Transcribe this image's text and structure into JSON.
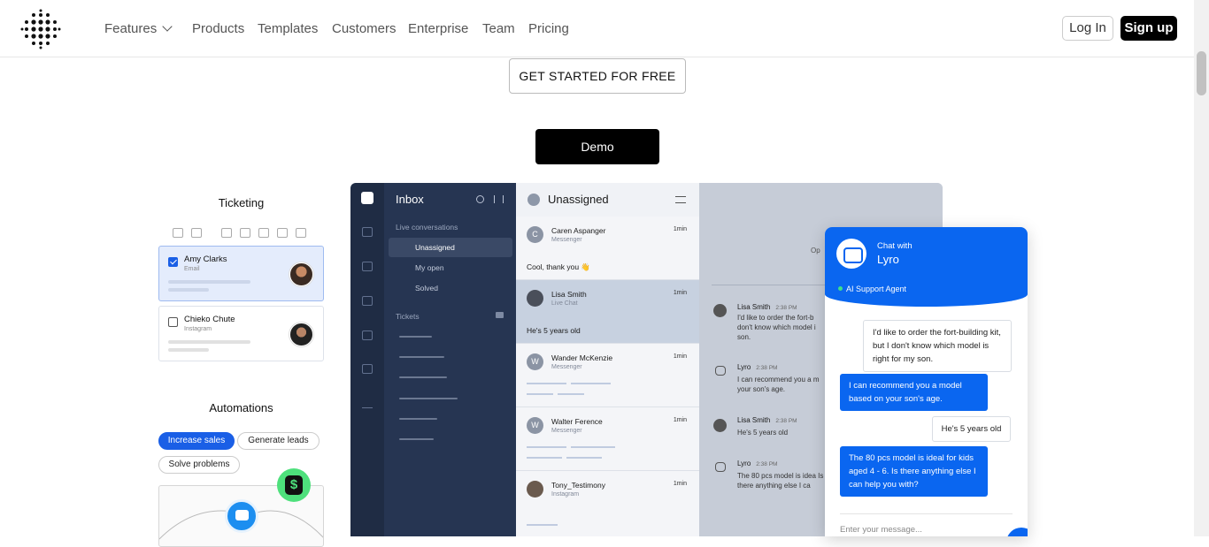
{
  "nav": {
    "items": [
      {
        "label": "Features"
      },
      {
        "label": "Products"
      },
      {
        "label": "Templates"
      },
      {
        "label": "Customers"
      },
      {
        "label": "Enterprise"
      },
      {
        "label": "Team"
      },
      {
        "label": "Pricing"
      }
    ],
    "login": "Log In",
    "signup": "Sign up"
  },
  "hero": {
    "cta_free": "GET STARTED FOR FREE",
    "cta_demo": "Demo"
  },
  "ticketing": {
    "title": "Ticketing",
    "tickets": [
      {
        "name": "Amy Clarks",
        "source": "Email"
      },
      {
        "name": "Chieko Chute",
        "source": "Instagram"
      }
    ]
  },
  "automations": {
    "title": "Automations",
    "pills": [
      "Increase sales",
      "Generate leads",
      "Solve problems"
    ],
    "dollar": "$"
  },
  "inbox": {
    "title": "Inbox",
    "live_section": "Live conversations",
    "live_items": [
      "Unassigned",
      "My open",
      "Solved"
    ],
    "tickets_section": "Tickets"
  },
  "conversations": {
    "title": "Unassigned",
    "items": [
      {
        "name": "Caren Aspanger",
        "source": "Messenger",
        "time": "1min",
        "message": "Cool, thank you 👋",
        "avatar": "C"
      },
      {
        "name": "Lisa Smith",
        "source": "Live Chat",
        "time": "1min",
        "message": "He's 5 years old",
        "avatar": ""
      },
      {
        "name": "Wander McKenzie",
        "source": "Messenger",
        "time": "1min",
        "avatar": "W"
      },
      {
        "name": "Walter Ference",
        "source": "Messenger",
        "time": "1min",
        "avatar": "W"
      },
      {
        "name": "Tony_Testimony",
        "source": "Instagram",
        "time": "1min",
        "avatar": ""
      }
    ]
  },
  "chat_pane": {
    "open_hint": "Op",
    "messages": [
      {
        "name": "Lisa Smith",
        "time": "2:38 PM",
        "text": "I'd like to order the fort-b don't know which model i son."
      },
      {
        "name": "Lyro",
        "time": "2:38 PM",
        "text": "I can recommend you a m your son's age."
      },
      {
        "name": "Lisa Smith",
        "time": "2:38 PM",
        "text": "He's 5 years old"
      },
      {
        "name": "Lyro",
        "time": "2:38 PM",
        "text": "The 80 pcs model is idea Is there anything else I ca"
      }
    ]
  },
  "widget": {
    "header_small": "Chat with",
    "header_name": "Lyro",
    "status": "AI Support Agent",
    "messages": [
      {
        "from": "user",
        "text": "I'd like to order the fort-building kit, but I don't know which model is right for my son."
      },
      {
        "from": "bot",
        "text": "I can recommend you a model based on your son's age."
      },
      {
        "from": "user",
        "text": "He's 5 years old"
      },
      {
        "from": "bot",
        "text": "The 80 pcs model is ideal for kids aged 4 - 6. Is there anything else I can help you with?"
      }
    ],
    "input_placeholder": "Enter your message..."
  },
  "colors": {
    "accent": "#0a66f0",
    "navy": "#1f2c44",
    "green": "#4ee07c"
  }
}
